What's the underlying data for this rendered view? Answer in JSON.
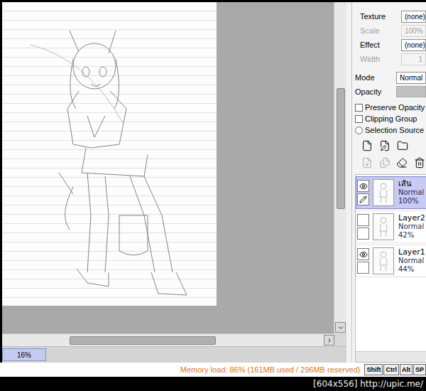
{
  "window": {
    "watermark": "[604x556] http://upic.me/"
  },
  "canvas": {
    "zoom": "16%",
    "vscroll": {
      "start": 0.26,
      "size": 0.36
    },
    "hscroll": {
      "start": 0.21,
      "size": 0.45
    }
  },
  "brush": [
    {
      "label": "Texture",
      "value": "(none)",
      "disabled": false,
      "kind": "dropdown"
    },
    {
      "label": "Scale",
      "value": "100%",
      "disabled": true,
      "kind": "field"
    },
    {
      "label": "Effect",
      "value": "(none)",
      "disabled": false,
      "kind": "dropdown"
    },
    {
      "label": "Width",
      "value": "1",
      "disabled": true,
      "kind": "field"
    }
  ],
  "layer_props": {
    "mode_label": "Mode",
    "mode_value": "Normal",
    "opacity_label": "Opacity",
    "opacity_level": 1,
    "options": [
      {
        "label": "Preserve Opacity",
        "kind": "checkbox",
        "checked": false
      },
      {
        "label": "Clipping Group",
        "kind": "checkbox",
        "checked": false
      },
      {
        "label": "Selection Source",
        "kind": "radio",
        "checked": false
      }
    ]
  },
  "layers": [
    {
      "name": "เส้น",
      "mode": "Normal",
      "opacity": "100%",
      "visible": true,
      "editing": true,
      "selected": true
    },
    {
      "name": "Layer2",
      "mode": "Normal",
      "opacity": "42%",
      "visible": false,
      "editing": false,
      "selected": false
    },
    {
      "name": "Layer1",
      "mode": "Normal",
      "opacity": "44%",
      "visible": true,
      "editing": false,
      "selected": false
    }
  ],
  "status_bar": {
    "memory": "Memory load: 86% (161MB used / 296MB reserved)",
    "keys": [
      {
        "label": "Shift"
      },
      {
        "label": "Ctrl"
      },
      {
        "label": "Alt"
      },
      {
        "label": "SP"
      }
    ]
  }
}
